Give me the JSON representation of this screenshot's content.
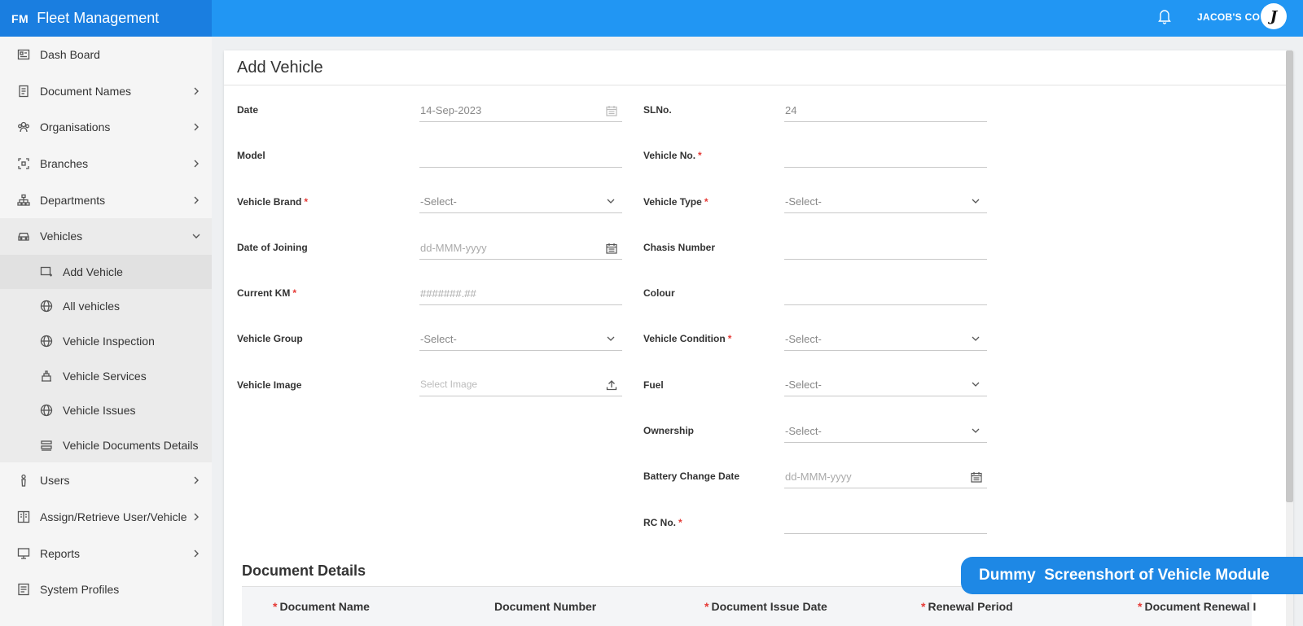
{
  "app": {
    "logo_text": "FM",
    "title": "Fleet Management"
  },
  "header": {
    "user_name": "JACOB'S CO",
    "avatar_letter": "J"
  },
  "sidebar": {
    "items": [
      {
        "label": "Dash Board",
        "icon": "dashboard-icon"
      },
      {
        "label": "Document Names",
        "icon": "document-icon",
        "has_arrow": true
      },
      {
        "label": "Organisations",
        "icon": "organisation-icon",
        "has_arrow": true
      },
      {
        "label": "Branches",
        "icon": "branch-icon",
        "has_arrow": true
      },
      {
        "label": "Departments",
        "icon": "department-icon",
        "has_arrow": true
      },
      {
        "label": "Vehicles",
        "icon": "car-icon",
        "expanded": true
      },
      {
        "label": "Users",
        "icon": "user-icon",
        "has_arrow": true
      },
      {
        "label": "Assign/Retrieve User/Vehicle",
        "icon": "assign-icon",
        "has_arrow": true
      },
      {
        "label": "Reports",
        "icon": "monitor-icon",
        "has_arrow": true
      },
      {
        "label": "System Profiles",
        "icon": "profile-icon"
      }
    ],
    "vehicle_subitems": [
      {
        "label": "Add Vehicle",
        "icon": "add-vehicle-icon",
        "active": true
      },
      {
        "label": "All vehicles",
        "icon": "globe-icon"
      },
      {
        "label": "Vehicle Inspection",
        "icon": "globe-icon"
      },
      {
        "label": "Vehicle Services",
        "icon": "service-icon"
      },
      {
        "label": "Vehicle Issues",
        "icon": "globe-icon"
      },
      {
        "label": "Vehicle Documents Details",
        "icon": "documents-icon"
      }
    ]
  },
  "form": {
    "title": "Add Vehicle",
    "left": [
      {
        "label": "Date",
        "value": "14-Sep-2023",
        "icon": "calendar-icon",
        "type": "date"
      },
      {
        "label": "Model",
        "value": ""
      },
      {
        "label": "Vehicle Brand",
        "required": true,
        "value": "-Select-",
        "icon": "chevron-down-icon",
        "type": "select"
      },
      {
        "label": "Date of Joining",
        "placeholder": "dd-MMM-yyyy",
        "icon": "calendar-icon",
        "type": "date"
      },
      {
        "label": "Current KM",
        "required": true,
        "placeholder": "#######.##"
      },
      {
        "label": "Vehicle Group",
        "value": "-Select-",
        "icon": "chevron-down-icon",
        "type": "select"
      },
      {
        "label": "Vehicle Image",
        "placeholder": "Select Image",
        "icon": "upload-icon",
        "type": "file"
      }
    ],
    "right": [
      {
        "label": "SLNo.",
        "value": "24"
      },
      {
        "label": "Vehicle No.",
        "required": true,
        "value": ""
      },
      {
        "label": "Vehicle Type",
        "required": true,
        "value": "-Select-",
        "icon": "chevron-down-icon",
        "type": "select"
      },
      {
        "label": "Chasis Number",
        "value": ""
      },
      {
        "label": "Colour",
        "value": ""
      },
      {
        "label": "Vehicle Condition",
        "required": true,
        "value": "-Select-",
        "icon": "chevron-down-icon",
        "type": "select"
      },
      {
        "label": "Fuel",
        "value": "-Select-",
        "icon": "chevron-down-icon",
        "type": "select"
      },
      {
        "label": "Ownership",
        "value": "-Select-",
        "icon": "chevron-down-icon",
        "type": "select"
      },
      {
        "label": "Battery Change Date",
        "placeholder": "dd-MMM-yyyy",
        "icon": "calendar-icon",
        "type": "date"
      },
      {
        "label": "RC No.",
        "required": true,
        "value": ""
      }
    ]
  },
  "documents": {
    "title": "Document Details",
    "columns": [
      {
        "label": "Document Name",
        "required": true
      },
      {
        "label": "Document Number",
        "required": false
      },
      {
        "label": "Document Issue Date",
        "required": true
      },
      {
        "label": "Renewal Period",
        "required": true
      },
      {
        "label": "Document Renewal I",
        "required": true
      }
    ]
  },
  "watermark": "Dummy  Screenshort of Vehicle Module",
  "colors": {
    "header": "#2196f3",
    "brand": "#1a7ee0",
    "badge": "#1e88e5",
    "required": "#e53935"
  }
}
